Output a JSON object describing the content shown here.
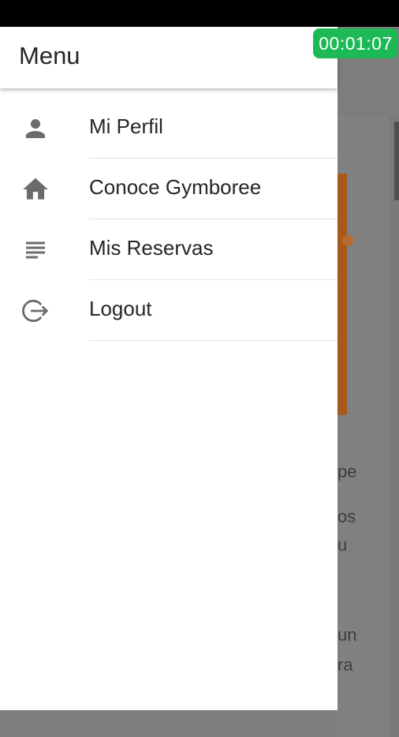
{
  "timer": {
    "value": "00:01:07"
  },
  "drawer": {
    "title": "Menu",
    "items": [
      {
        "label": "Mi Perfil",
        "icon": "person-icon"
      },
      {
        "label": "Conoce Gymboree",
        "icon": "home-icon"
      },
      {
        "label": "Mis Reservas",
        "icon": "list-icon"
      },
      {
        "label": "Logout",
        "icon": "logout-icon"
      }
    ]
  },
  "background": {
    "text_fragments": [
      "pe",
      "os",
      "u",
      "un",
      "ra"
    ]
  },
  "colors": {
    "timer_bg": "#1db954",
    "icon_gray": "#6b6b6b",
    "accent_orange": "#a85a1a"
  }
}
